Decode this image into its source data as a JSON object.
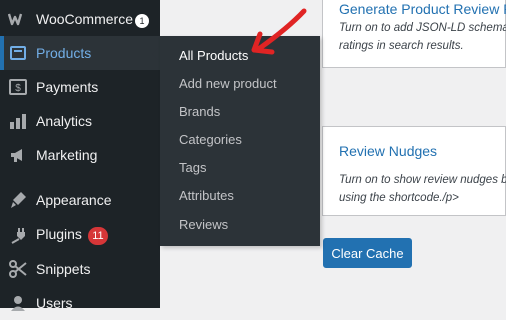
{
  "sidebar": {
    "items": [
      {
        "label": "WooCommerce",
        "icon": "woocommerce-icon",
        "badge": "1"
      },
      {
        "label": "Products",
        "icon": "products-icon"
      },
      {
        "label": "Payments",
        "icon": "payments-icon"
      },
      {
        "label": "Analytics",
        "icon": "analytics-icon"
      },
      {
        "label": "Marketing",
        "icon": "marketing-icon"
      },
      {
        "label": "Appearance",
        "icon": "appearance-icon"
      },
      {
        "label": "Plugins",
        "icon": "plugins-icon",
        "badge": "11"
      },
      {
        "label": "Snippets",
        "icon": "snippets-icon"
      },
      {
        "label": "Users",
        "icon": "users-icon"
      }
    ]
  },
  "submenu": {
    "items": [
      "All Products",
      "Add new product",
      "Brands",
      "Categories",
      "Tags",
      "Attributes",
      "Reviews"
    ]
  },
  "main": {
    "card1": {
      "title": "Generate Product Review R",
      "desc_line1": "Turn on to add JSON-LD schema",
      "desc_line2": "ratings in search results."
    },
    "card2": {
      "title": "Review Nudges",
      "desc_line1": "Turn on to show review nudges b",
      "desc_line2": "using the shortcode./p>"
    },
    "clear_cache_label": "Clear Cache"
  },
  "colors": {
    "sidebar_bg": "#1d2327",
    "submenu_bg": "#2c3338",
    "accent": "#2271b1",
    "badge": "#d63638",
    "annotation_arrow": "#e02424"
  }
}
